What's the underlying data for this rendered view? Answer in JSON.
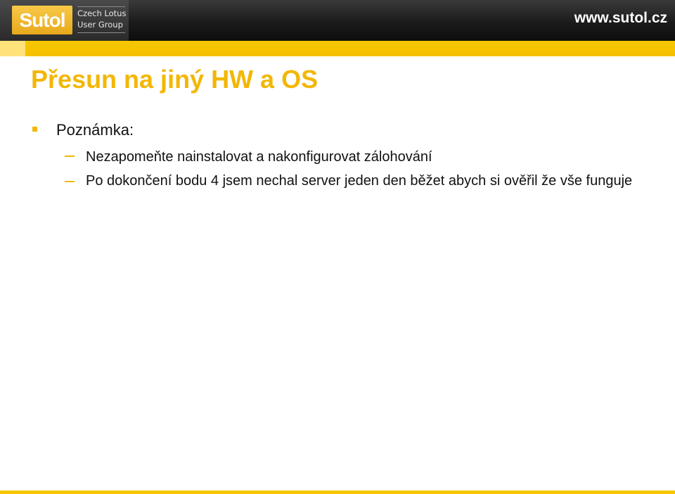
{
  "header": {
    "logo": {
      "brand": "Sutol",
      "subtitle_line1": "Czech Lotus",
      "subtitle_line2": "User Group"
    },
    "site_url": "www.sutol.cz",
    "colors": {
      "bar": "#1b1b1b",
      "accent": "#f6c700",
      "logo": "#f0b723"
    }
  },
  "slide": {
    "title": "Přesun na jiný HW a OS",
    "title_color": "#f2b705",
    "bullet_icon": "square-bullet-icon",
    "sub_bullet_icon": "dash-bullet-icon",
    "items": [
      {
        "text": "Poznámka:",
        "children": [
          {
            "text": "Nezapomeňte nainstalovat a nakonfigurovat zálohování"
          },
          {
            "text": "Po dokončení bodu 4 jsem nechal server jeden den běžet abych si ověřil že vše funguje"
          }
        ]
      }
    ]
  }
}
